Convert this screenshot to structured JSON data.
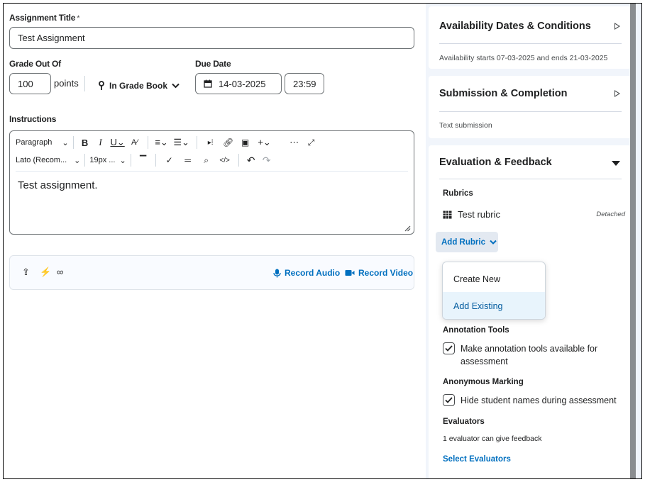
{
  "assignment": {
    "title_label": "Assignment Title",
    "required_mark": "*",
    "title_value": "Test Assignment"
  },
  "grade": {
    "label": "Grade Out Of",
    "value": "100",
    "unit": "points",
    "gradebook_label": "In Grade Book"
  },
  "due": {
    "label": "Due Date",
    "date": "14-03-2025",
    "time": "23:59"
  },
  "instructions": {
    "label": "Instructions",
    "toolbar": {
      "paragraph": "Paragraph",
      "font": "Lato (Recom...",
      "size": "19px ..."
    },
    "content": "Test assignment."
  },
  "attachments": {
    "record_audio": "Record Audio",
    "record_video": "Record Video"
  },
  "panel": {
    "availability": {
      "title": "Availability Dates & Conditions",
      "summary": "Availability starts 07-03-2025 and ends 21-03-2025"
    },
    "submission": {
      "title": "Submission & Completion",
      "summary": "Text submission"
    },
    "evaluation": {
      "title": "Evaluation & Feedback",
      "rubrics_label": "Rubrics",
      "rubric_name": "Test rubric",
      "rubric_status": "Detached",
      "add_rubric": "Add Rubric",
      "menu": [
        "Create New",
        "Add Existing"
      ],
      "annotation_label": "Annotation Tools",
      "annotation_text_1": "Make annotation tools available for",
      "annotation_text_2": "assessment",
      "anonymous_label": "Anonymous Marking",
      "anonymous_text": "Hide student names during assessment",
      "evaluators_label": "Evaluators",
      "evaluators_text": "1 evaluator can give feedback",
      "select_evaluators": "Select Evaluators"
    }
  },
  "colors": {
    "link": "#006fbf",
    "panel_bg": "#f1f5fb",
    "menu_highlight": "#e8f4fc"
  }
}
